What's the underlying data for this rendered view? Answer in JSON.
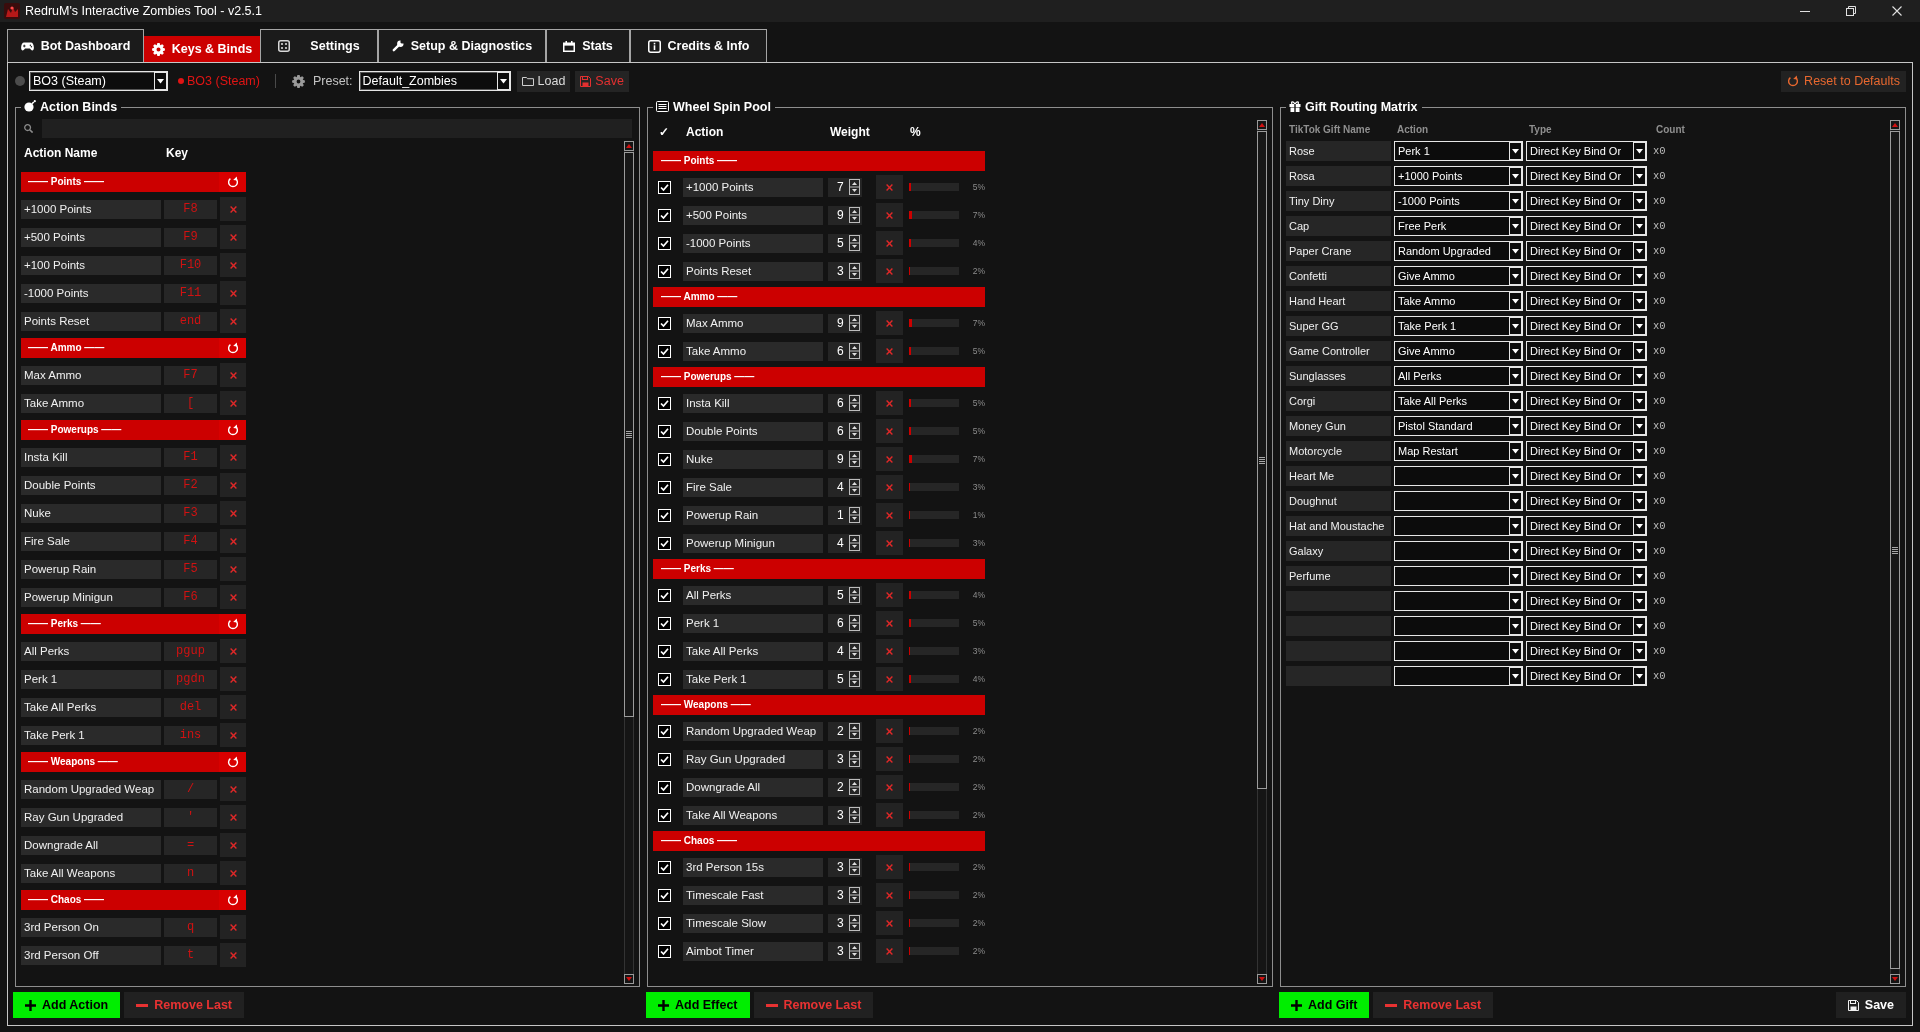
{
  "window": {
    "title": "RedruM's Interactive Zombies Tool - v2.5.1"
  },
  "tabs": [
    {
      "label": "Bot Dashboard",
      "selected": false
    },
    {
      "label": "Keys & Binds",
      "selected": true
    },
    {
      "label": "Settings",
      "selected": false
    },
    {
      "label": "Setup & Diagnostics",
      "selected": false
    },
    {
      "label": "Stats",
      "selected": false
    },
    {
      "label": "Credits & Info",
      "selected": false
    }
  ],
  "toolbar": {
    "game_select": "BO3 (Steam)",
    "game_status": "BO3 (Steam)",
    "preset_label": "Preset:",
    "preset_select": "Default_Zombies",
    "buttons": [
      {
        "kind": "load",
        "label": "Load"
      },
      {
        "kind": "save",
        "label": "Save"
      }
    ],
    "reset_button": "Reset to Defaults"
  },
  "action_binds": {
    "title": "Action Binds",
    "columns": [
      "Action Name",
      "Key"
    ],
    "groups": [
      {
        "title": "—— Points ——",
        "items": [
          {
            "name": "+1000 Points",
            "key": "F8"
          },
          {
            "name": "+500 Points",
            "key": "F9"
          },
          {
            "name": "+100 Points",
            "key": "F10"
          },
          {
            "name": "-1000 Points",
            "key": "F11"
          },
          {
            "name": "Points Reset",
            "key": "end"
          }
        ]
      },
      {
        "title": "—— Ammo ——",
        "items": [
          {
            "name": "Max Ammo",
            "key": "F7"
          },
          {
            "name": "Take Ammo",
            "key": "["
          }
        ]
      },
      {
        "title": "—— Powerups ——",
        "items": [
          {
            "name": "Insta Kill",
            "key": "F1"
          },
          {
            "name": "Double Points",
            "key": "F2"
          },
          {
            "name": "Nuke",
            "key": "F3"
          },
          {
            "name": "Fire Sale",
            "key": "F4"
          },
          {
            "name": "Powerup Rain",
            "key": "F5"
          },
          {
            "name": "Powerup Minigun",
            "key": "F6"
          }
        ]
      },
      {
        "title": "—— Perks ——",
        "items": [
          {
            "name": "All Perks",
            "key": "pgup"
          },
          {
            "name": "Perk 1",
            "key": "pgdn"
          },
          {
            "name": "Take All Perks",
            "key": "del"
          },
          {
            "name": "Take Perk 1",
            "key": "ins"
          }
        ]
      },
      {
        "title": "—— Weapons ——",
        "items": [
          {
            "name": "Random Upgraded Weap",
            "key": "/"
          },
          {
            "name": "Ray Gun Upgraded",
            "key": "'"
          },
          {
            "name": "Downgrade All",
            "key": "="
          },
          {
            "name": "Take All Weapons",
            "key": "n"
          }
        ]
      },
      {
        "title": "—— Chaos ——",
        "items": [
          {
            "name": "3rd Person On",
            "key": "q"
          },
          {
            "name": "3rd Person Off",
            "key": "t"
          }
        ]
      }
    ],
    "buttons": [
      {
        "kind": "add",
        "label": "Add Action"
      },
      {
        "kind": "remove",
        "label": "Remove Last"
      }
    ]
  },
  "wheel_spin_pool": {
    "title": "Wheel Spin Pool",
    "columns": [
      "✓",
      "Action",
      "Weight",
      "%"
    ],
    "groups": [
      {
        "title": "—— Points ——",
        "items": [
          {
            "checked": true,
            "name": "+1000 Points",
            "weight": "7",
            "level": 0.055,
            "percent": "5%"
          },
          {
            "checked": true,
            "name": "+500 Points",
            "weight": "9",
            "level": 0.07,
            "percent": "7%"
          },
          {
            "checked": true,
            "name": "-1000 Points",
            "weight": "5",
            "level": 0.039,
            "percent": "4%"
          },
          {
            "checked": true,
            "name": "Points Reset",
            "weight": "3",
            "level": 0.023,
            "percent": "2%"
          }
        ]
      },
      {
        "title": "—— Ammo ——",
        "items": [
          {
            "checked": true,
            "name": "Max Ammo",
            "weight": "9",
            "level": 0.07,
            "percent": "7%"
          },
          {
            "checked": true,
            "name": "Take Ammo",
            "weight": "6",
            "level": 0.047,
            "percent": "5%"
          }
        ]
      },
      {
        "title": "—— Powerups ——",
        "items": [
          {
            "checked": true,
            "name": "Insta Kill",
            "weight": "6",
            "level": 0.047,
            "percent": "5%"
          },
          {
            "checked": true,
            "name": "Double Points",
            "weight": "6",
            "level": 0.047,
            "percent": "5%"
          },
          {
            "checked": true,
            "name": "Nuke",
            "weight": "9",
            "level": 0.07,
            "percent": "7%"
          },
          {
            "checked": true,
            "name": "Fire Sale",
            "weight": "4",
            "level": 0.031,
            "percent": "3%"
          },
          {
            "checked": true,
            "name": "Powerup Rain",
            "weight": "1",
            "level": 0.008,
            "percent": "1%"
          },
          {
            "checked": true,
            "name": "Powerup Minigun",
            "weight": "4",
            "level": 0.031,
            "percent": "3%"
          }
        ]
      },
      {
        "title": "—— Perks ——",
        "items": [
          {
            "checked": true,
            "name": "All Perks",
            "weight": "5",
            "level": 0.039,
            "percent": "4%"
          },
          {
            "checked": true,
            "name": "Perk 1",
            "weight": "6",
            "level": 0.047,
            "percent": "5%"
          },
          {
            "checked": true,
            "name": "Take All Perks",
            "weight": "4",
            "level": 0.031,
            "percent": "3%"
          },
          {
            "checked": true,
            "name": "Take Perk 1",
            "weight": "5",
            "level": 0.039,
            "percent": "4%"
          }
        ]
      },
      {
        "title": "—— Weapons ——",
        "items": [
          {
            "checked": true,
            "name": "Random Upgraded Weap",
            "weight": "2",
            "level": 0.016,
            "percent": "2%"
          },
          {
            "checked": true,
            "name": "Ray Gun Upgraded",
            "weight": "3",
            "level": 0.023,
            "percent": "2%"
          },
          {
            "checked": true,
            "name": "Downgrade All",
            "weight": "2",
            "level": 0.016,
            "percent": "2%"
          },
          {
            "checked": true,
            "name": "Take All Weapons",
            "weight": "3",
            "level": 0.023,
            "percent": "2%"
          }
        ]
      },
      {
        "title": "—— Chaos ——",
        "items": [
          {
            "checked": true,
            "name": "3rd Person 15s",
            "weight": "3",
            "level": 0.023,
            "percent": "2%"
          },
          {
            "checked": true,
            "name": "Timescale Fast",
            "weight": "3",
            "level": 0.023,
            "percent": "2%"
          },
          {
            "checked": true,
            "name": "Timescale Slow",
            "weight": "3",
            "level": 0.023,
            "percent": "2%"
          },
          {
            "checked": true,
            "name": "Aimbot Timer",
            "weight": "3",
            "level": 0.023,
            "percent": "2%"
          }
        ]
      }
    ],
    "buttons": [
      {
        "kind": "add",
        "label": "Add Effect"
      },
      {
        "kind": "remove",
        "label": "Remove Last"
      }
    ]
  },
  "gift_routing_matrix": {
    "title": "Gift Routing Matrix",
    "columns": [
      "TikTok Gift Name",
      "Action",
      "Type",
      "Count"
    ],
    "rows": [
      {
        "gift": "Rose",
        "action": "Perk 1",
        "type": "Direct Key Bind Or",
        "count": "x0"
      },
      {
        "gift": "Rosa",
        "action": "+1000 Points",
        "type": "Direct Key Bind Or",
        "count": "x0"
      },
      {
        "gift": "Tiny Diny",
        "action": "-1000 Points",
        "type": "Direct Key Bind Or",
        "count": "x0"
      },
      {
        "gift": "Cap",
        "action": "Free Perk",
        "type": "Direct Key Bind Or",
        "count": "x0"
      },
      {
        "gift": "Paper Crane",
        "action": "Random Upgraded",
        "type": "Direct Key Bind Or",
        "count": "x0"
      },
      {
        "gift": "Confetti",
        "action": "Give Ammo",
        "type": "Direct Key Bind Or",
        "count": "x0"
      },
      {
        "gift": "Hand Heart",
        "action": "Take Ammo",
        "type": "Direct Key Bind Or",
        "count": "x0"
      },
      {
        "gift": "Super GG",
        "action": "Take Perk 1",
        "type": "Direct Key Bind Or",
        "count": "x0"
      },
      {
        "gift": "Game Controller",
        "action": "Give Ammo",
        "type": "Direct Key Bind Or",
        "count": "x0"
      },
      {
        "gift": "Sunglasses",
        "action": "All Perks",
        "type": "Direct Key Bind Or",
        "count": "x0"
      },
      {
        "gift": "Corgi",
        "action": "Take All Perks",
        "type": "Direct Key Bind Or",
        "count": "x0"
      },
      {
        "gift": "Money Gun",
        "action": "Pistol Standard",
        "type": "Direct Key Bind Or",
        "count": "x0"
      },
      {
        "gift": "Motorcycle",
        "action": "Map Restart",
        "type": "Direct Key Bind Or",
        "count": "x0"
      },
      {
        "gift": "Heart Me",
        "type": "Direct Key Bind Or",
        "count": "x0"
      },
      {
        "gift": "Doughnut",
        "type": "Direct Key Bind Or",
        "count": "x0"
      },
      {
        "gift": "Hat and Moustache",
        "type": "Direct Key Bind Or",
        "count": "x0"
      },
      {
        "gift": "Galaxy",
        "type": "Direct Key Bind Or",
        "count": "x0"
      },
      {
        "gift": "Perfume",
        "type": "Direct Key Bind Or",
        "count": "x0"
      },
      {
        "type": "Direct Key Bind Or",
        "count": "x0"
      },
      {
        "type": "Direct Key Bind Or",
        "count": "x0"
      },
      {
        "type": "Direct Key Bind Or",
        "count": "x0"
      },
      {
        "type": "Direct Key Bind Or",
        "count": "x0"
      }
    ],
    "buttons": [
      {
        "kind": "add",
        "label": "Add Gift"
      },
      {
        "kind": "remove",
        "label": "Remove Last"
      },
      {
        "kind": "save",
        "label": "Save"
      }
    ]
  }
}
